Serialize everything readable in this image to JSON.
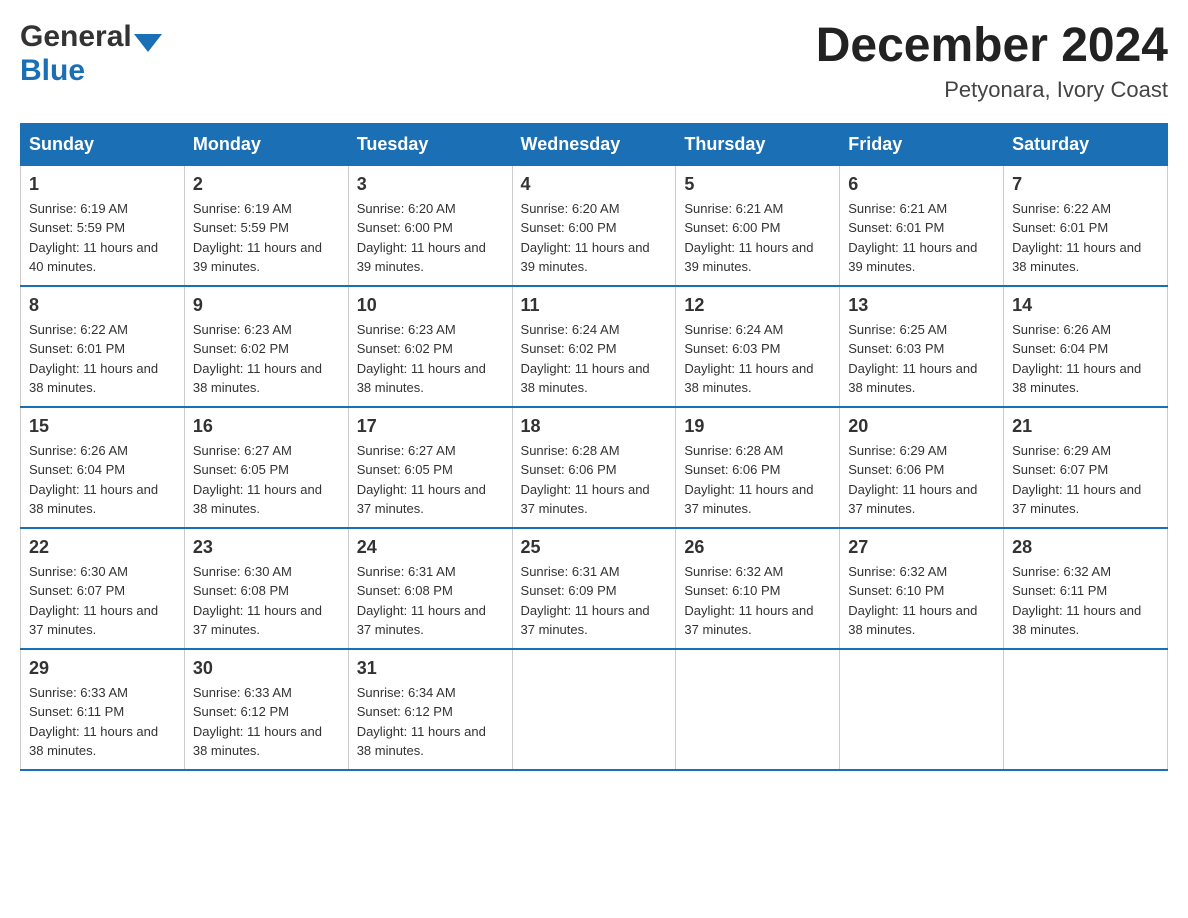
{
  "header": {
    "logo_general": "General",
    "logo_blue": "Blue",
    "month_title": "December 2024",
    "location": "Petyonara, Ivory Coast"
  },
  "days_of_week": [
    "Sunday",
    "Monday",
    "Tuesday",
    "Wednesday",
    "Thursday",
    "Friday",
    "Saturday"
  ],
  "weeks": [
    [
      {
        "day": "1",
        "sunrise": "6:19 AM",
        "sunset": "5:59 PM",
        "daylight": "11 hours and 40 minutes."
      },
      {
        "day": "2",
        "sunrise": "6:19 AM",
        "sunset": "5:59 PM",
        "daylight": "11 hours and 39 minutes."
      },
      {
        "day": "3",
        "sunrise": "6:20 AM",
        "sunset": "6:00 PM",
        "daylight": "11 hours and 39 minutes."
      },
      {
        "day": "4",
        "sunrise": "6:20 AM",
        "sunset": "6:00 PM",
        "daylight": "11 hours and 39 minutes."
      },
      {
        "day": "5",
        "sunrise": "6:21 AM",
        "sunset": "6:00 PM",
        "daylight": "11 hours and 39 minutes."
      },
      {
        "day": "6",
        "sunrise": "6:21 AM",
        "sunset": "6:01 PM",
        "daylight": "11 hours and 39 minutes."
      },
      {
        "day": "7",
        "sunrise": "6:22 AM",
        "sunset": "6:01 PM",
        "daylight": "11 hours and 38 minutes."
      }
    ],
    [
      {
        "day": "8",
        "sunrise": "6:22 AM",
        "sunset": "6:01 PM",
        "daylight": "11 hours and 38 minutes."
      },
      {
        "day": "9",
        "sunrise": "6:23 AM",
        "sunset": "6:02 PM",
        "daylight": "11 hours and 38 minutes."
      },
      {
        "day": "10",
        "sunrise": "6:23 AM",
        "sunset": "6:02 PM",
        "daylight": "11 hours and 38 minutes."
      },
      {
        "day": "11",
        "sunrise": "6:24 AM",
        "sunset": "6:02 PM",
        "daylight": "11 hours and 38 minutes."
      },
      {
        "day": "12",
        "sunrise": "6:24 AM",
        "sunset": "6:03 PM",
        "daylight": "11 hours and 38 minutes."
      },
      {
        "day": "13",
        "sunrise": "6:25 AM",
        "sunset": "6:03 PM",
        "daylight": "11 hours and 38 minutes."
      },
      {
        "day": "14",
        "sunrise": "6:26 AM",
        "sunset": "6:04 PM",
        "daylight": "11 hours and 38 minutes."
      }
    ],
    [
      {
        "day": "15",
        "sunrise": "6:26 AM",
        "sunset": "6:04 PM",
        "daylight": "11 hours and 38 minutes."
      },
      {
        "day": "16",
        "sunrise": "6:27 AM",
        "sunset": "6:05 PM",
        "daylight": "11 hours and 38 minutes."
      },
      {
        "day": "17",
        "sunrise": "6:27 AM",
        "sunset": "6:05 PM",
        "daylight": "11 hours and 37 minutes."
      },
      {
        "day": "18",
        "sunrise": "6:28 AM",
        "sunset": "6:06 PM",
        "daylight": "11 hours and 37 minutes."
      },
      {
        "day": "19",
        "sunrise": "6:28 AM",
        "sunset": "6:06 PM",
        "daylight": "11 hours and 37 minutes."
      },
      {
        "day": "20",
        "sunrise": "6:29 AM",
        "sunset": "6:06 PM",
        "daylight": "11 hours and 37 minutes."
      },
      {
        "day": "21",
        "sunrise": "6:29 AM",
        "sunset": "6:07 PM",
        "daylight": "11 hours and 37 minutes."
      }
    ],
    [
      {
        "day": "22",
        "sunrise": "6:30 AM",
        "sunset": "6:07 PM",
        "daylight": "11 hours and 37 minutes."
      },
      {
        "day": "23",
        "sunrise": "6:30 AM",
        "sunset": "6:08 PM",
        "daylight": "11 hours and 37 minutes."
      },
      {
        "day": "24",
        "sunrise": "6:31 AM",
        "sunset": "6:08 PM",
        "daylight": "11 hours and 37 minutes."
      },
      {
        "day": "25",
        "sunrise": "6:31 AM",
        "sunset": "6:09 PM",
        "daylight": "11 hours and 37 minutes."
      },
      {
        "day": "26",
        "sunrise": "6:32 AM",
        "sunset": "6:10 PM",
        "daylight": "11 hours and 37 minutes."
      },
      {
        "day": "27",
        "sunrise": "6:32 AM",
        "sunset": "6:10 PM",
        "daylight": "11 hours and 38 minutes."
      },
      {
        "day": "28",
        "sunrise": "6:32 AM",
        "sunset": "6:11 PM",
        "daylight": "11 hours and 38 minutes."
      }
    ],
    [
      {
        "day": "29",
        "sunrise": "6:33 AM",
        "sunset": "6:11 PM",
        "daylight": "11 hours and 38 minutes."
      },
      {
        "day": "30",
        "sunrise": "6:33 AM",
        "sunset": "6:12 PM",
        "daylight": "11 hours and 38 minutes."
      },
      {
        "day": "31",
        "sunrise": "6:34 AM",
        "sunset": "6:12 PM",
        "daylight": "11 hours and 38 minutes."
      },
      null,
      null,
      null,
      null
    ]
  ]
}
